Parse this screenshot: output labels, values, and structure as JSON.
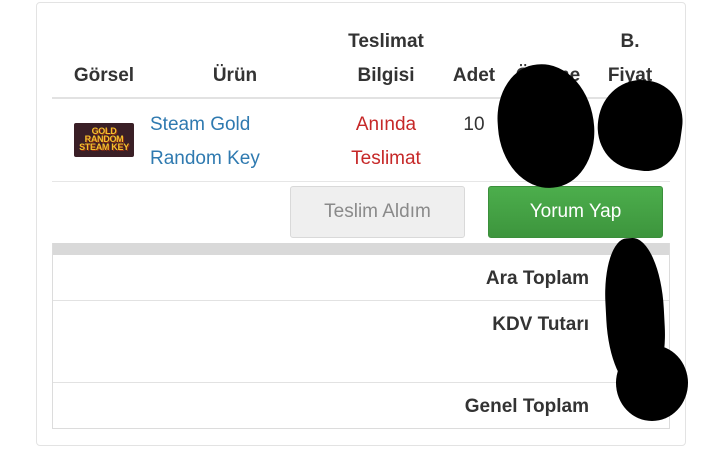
{
  "table": {
    "headers": {
      "image": "Görsel",
      "product": "Ürün",
      "delivery_line1": "Teslimat",
      "delivery_line2": "Bilgisi",
      "quantity": "Adet",
      "payment_partial": "Ödeme",
      "unit_price_line1": "B.",
      "unit_price_line2": "Fiyat"
    },
    "row": {
      "thumbnail_text": "GOLD RANDOM STEAM KEY",
      "product_line1": "Steam Gold",
      "product_line2": "Random Key",
      "delivery_line1": "Anında",
      "delivery_line2": "Teslimat",
      "quantity": "10"
    }
  },
  "buttons": {
    "received": "Teslim Aldım",
    "review": "Yorum Yap"
  },
  "totals": {
    "subtotal_label": "Ara Toplam",
    "vat_label": "KDV Tutarı",
    "grand_total_label": "Genel Toplam"
  },
  "colors": {
    "link": "#2f7ab0",
    "delivery_status": "#c62828",
    "review_button": "#45a745",
    "received_button": "#efefef"
  }
}
